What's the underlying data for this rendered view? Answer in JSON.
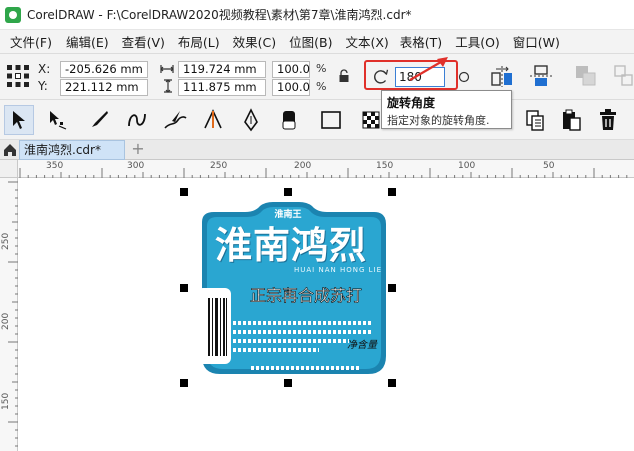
{
  "window": {
    "title": "CorelDRAW - F:\\CorelDRAW2020视频教程\\素材\\第7章\\淮南鸿烈.cdr*"
  },
  "menu": [
    {
      "label": "文件(F)"
    },
    {
      "label": "编辑(E)"
    },
    {
      "label": "查看(V)"
    },
    {
      "label": "布局(L)"
    },
    {
      "label": "效果(C)"
    },
    {
      "label": "位图(B)"
    },
    {
      "label": "文本(X)"
    },
    {
      "label": "表格(T)"
    },
    {
      "label": "工具(O)"
    },
    {
      "label": "窗口(W)"
    }
  ],
  "propbar": {
    "x_label": "X:",
    "y_label": "Y:",
    "x_value": "-205.626 mm",
    "y_value": "221.112 mm",
    "w_value": "119.724 mm",
    "h_value": "111.875 mm",
    "scale_w": "100.0",
    "scale_h": "100.0",
    "percent": "%",
    "rotation_value": "180"
  },
  "tooltip": {
    "title": "旋转角度",
    "description": "指定对象的旋转角度."
  },
  "tabs": {
    "document": "淮南鸿烈.cdr*",
    "add": "+"
  },
  "rulers": {
    "top": [
      "350",
      "300",
      "250",
      "200",
      "150",
      "100",
      "50"
    ],
    "left": [
      "250",
      "200",
      "150"
    ]
  },
  "artwork": {
    "small_title": "淮南王",
    "main_title": "淮南鸿烈",
    "pinyin": "HUAI NAN HONG LIE",
    "subtitle": "正宗再合成苏打",
    "corner_text": "净含量"
  },
  "colors": {
    "label_blue": "#2aa6d1",
    "label_dark": "#1b84b0",
    "highlight_red": "#e0302a"
  }
}
